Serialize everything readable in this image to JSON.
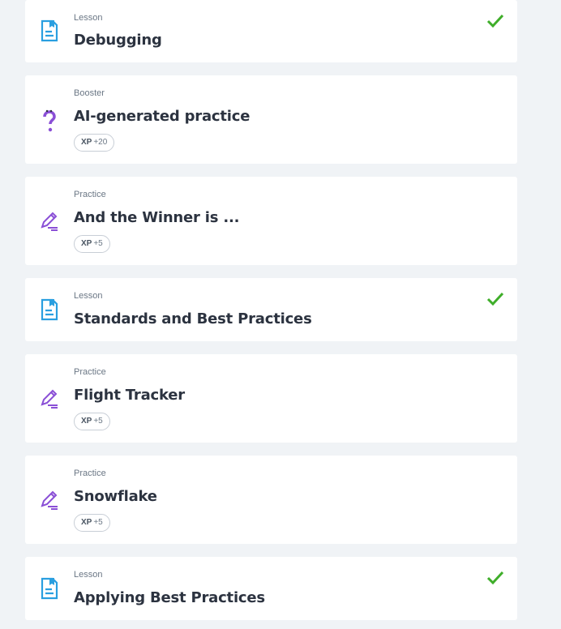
{
  "items": [
    {
      "kind": "Lesson",
      "title": "Debugging",
      "xp": null,
      "completed": true,
      "icon": "lesson-icon"
    },
    {
      "kind": "Booster",
      "title": "AI-generated practice",
      "xp": {
        "label": "XP",
        "value": "+20"
      },
      "completed": false,
      "icon": "booster-question-icon"
    },
    {
      "kind": "Practice",
      "title": "And the Winner is ...",
      "xp": {
        "label": "XP",
        "value": "+5"
      },
      "completed": false,
      "icon": "practice-pencil-icon"
    },
    {
      "kind": "Lesson",
      "title": "Standards and Best Practices",
      "xp": null,
      "completed": true,
      "icon": "lesson-icon"
    },
    {
      "kind": "Practice",
      "title": "Flight Tracker",
      "xp": {
        "label": "XP",
        "value": "+5"
      },
      "completed": false,
      "icon": "practice-pencil-icon"
    },
    {
      "kind": "Practice",
      "title": "Snowflake",
      "xp": {
        "label": "XP",
        "value": "+5"
      },
      "completed": false,
      "icon": "practice-pencil-icon"
    },
    {
      "kind": "Lesson",
      "title": "Applying Best Practices",
      "xp": null,
      "completed": true,
      "icon": "lesson-icon"
    }
  ],
  "colors": {
    "lesson": "#2a9fe0",
    "practice": "#8a4fd6",
    "check": "#3fae2a"
  }
}
